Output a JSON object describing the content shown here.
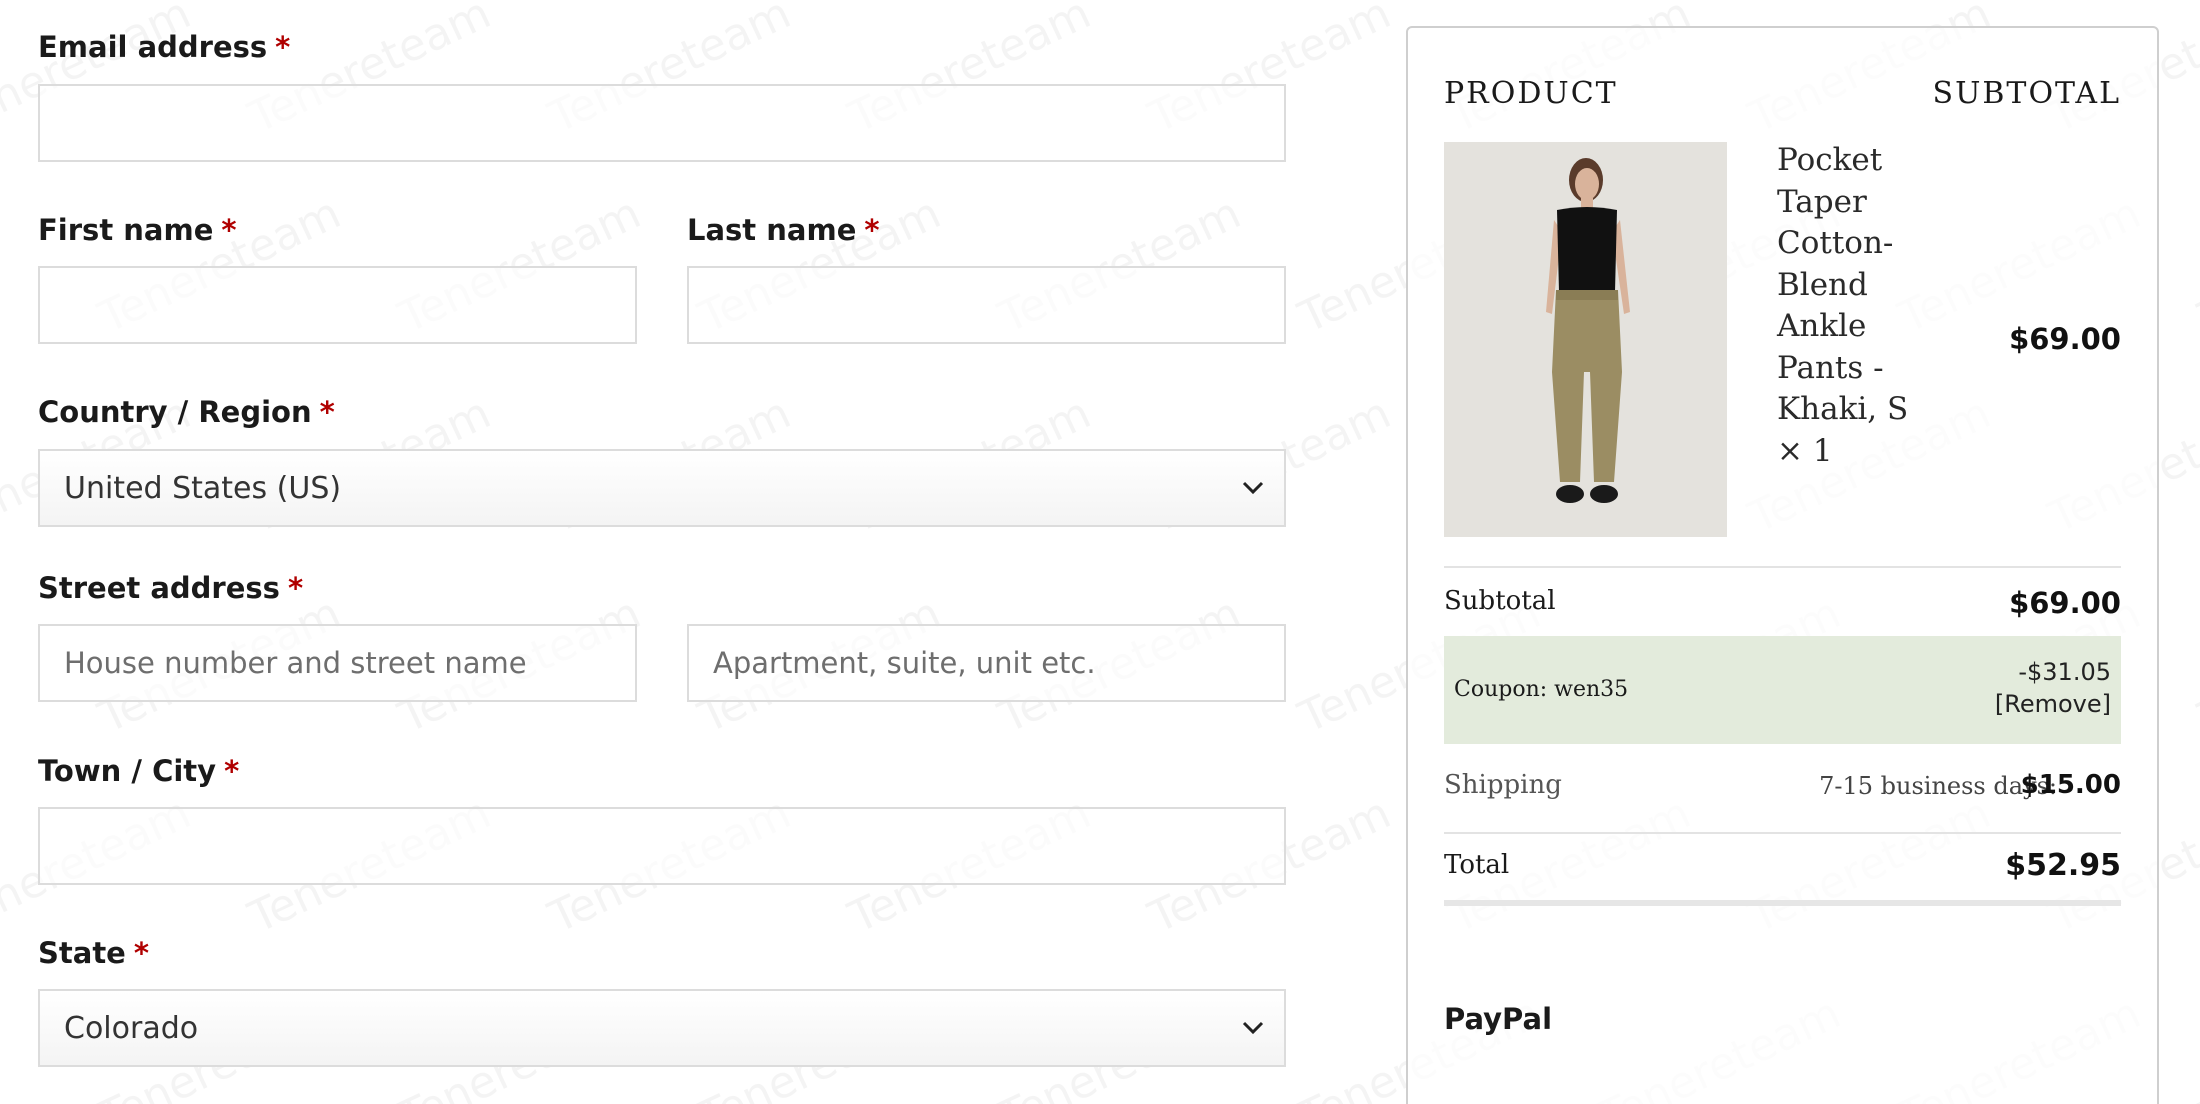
{
  "form": {
    "email": {
      "label": "Email address",
      "required_mark": "*",
      "value": ""
    },
    "first_name": {
      "label": "First name",
      "required_mark": "*",
      "value": ""
    },
    "last_name": {
      "label": "Last name",
      "required_mark": "*",
      "value": ""
    },
    "country": {
      "label": "Country / Region",
      "required_mark": "*",
      "value": "United States (US)"
    },
    "street": {
      "label": "Street address",
      "required_mark": "*",
      "placeholder_1": "House number and street name",
      "placeholder_2": "Apartment, suite, unit etc."
    },
    "city": {
      "label": "Town / City",
      "required_mark": "*",
      "value": ""
    },
    "state": {
      "label": "State",
      "required_mark": "*",
      "value": "Colorado"
    }
  },
  "summary": {
    "product_header": "PRODUCT",
    "subtotal_header": "SUBTOTAL",
    "item": {
      "name": "Pocket Taper Cotton-Blend Ankle Pants - Khaki, S",
      "qty": "× 1",
      "price": "$69.00"
    },
    "subtotal": {
      "label": "Subtotal",
      "value": "$69.00"
    },
    "coupon": {
      "label": "Coupon: wen35",
      "amount": "-$31.05",
      "remove": "[Remove]"
    },
    "shipping": {
      "label": "Shipping",
      "detail": "7-15 business days:",
      "value": "$15.00"
    },
    "total": {
      "label": "Total",
      "value": "$52.95"
    },
    "payment_method": "PayPal"
  },
  "watermark_text": "Tenereteam",
  "colors": {
    "required": "#b00000",
    "coupon_bg": "#e3ebdc",
    "border": "#dcdcdc"
  }
}
